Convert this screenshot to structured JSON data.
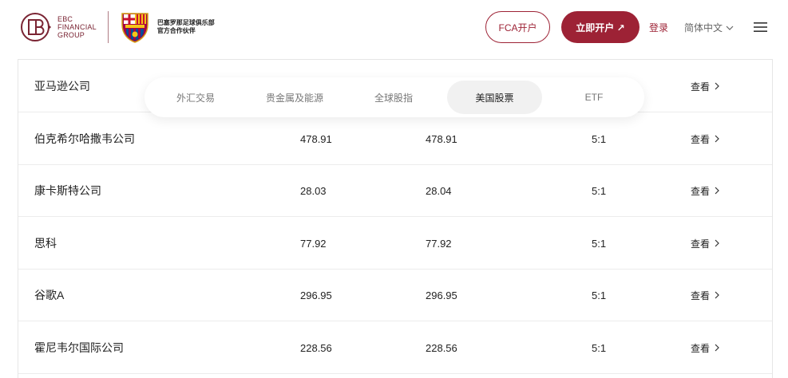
{
  "header": {
    "ebc_lines": [
      "EBC",
      "FINANCIAL",
      "GROUP"
    ],
    "partner_lines": [
      "巴塞罗那足球俱乐部",
      "官方合作伙伴"
    ],
    "fca_label": "FCA开户",
    "open_label": "立即开户 ↗",
    "login_label": "登录",
    "language_label": "简体中文"
  },
  "tabs": [
    {
      "label": "外汇交易",
      "active": false
    },
    {
      "label": "贵金属及能源",
      "active": false
    },
    {
      "label": "全球股指",
      "active": false
    },
    {
      "label": "美国股票",
      "active": true
    },
    {
      "label": "ETF",
      "active": false
    }
  ],
  "table": {
    "view_label": "查看",
    "rows": [
      {
        "name": "亚马逊公司",
        "bid": "",
        "ask": "",
        "leverage": ""
      },
      {
        "name": "伯克希尔哈撒韦公司",
        "bid": "478.91",
        "ask": "478.91",
        "leverage": "5:1"
      },
      {
        "name": "康卡斯特公司",
        "bid": "28.03",
        "ask": "28.04",
        "leverage": "5:1"
      },
      {
        "name": "思科",
        "bid": "77.92",
        "ask": "77.92",
        "leverage": "5:1"
      },
      {
        "name": "谷歌A",
        "bid": "296.95",
        "ask": "296.95",
        "leverage": "5:1"
      },
      {
        "name": "霍尼韦尔国际公司",
        "bid": "228.56",
        "ask": "228.56",
        "leverage": "5:1"
      }
    ]
  },
  "colors": {
    "brand": "#9d2235",
    "logo": "#7a2433",
    "tab_active_bg": "#f1f1f1"
  }
}
